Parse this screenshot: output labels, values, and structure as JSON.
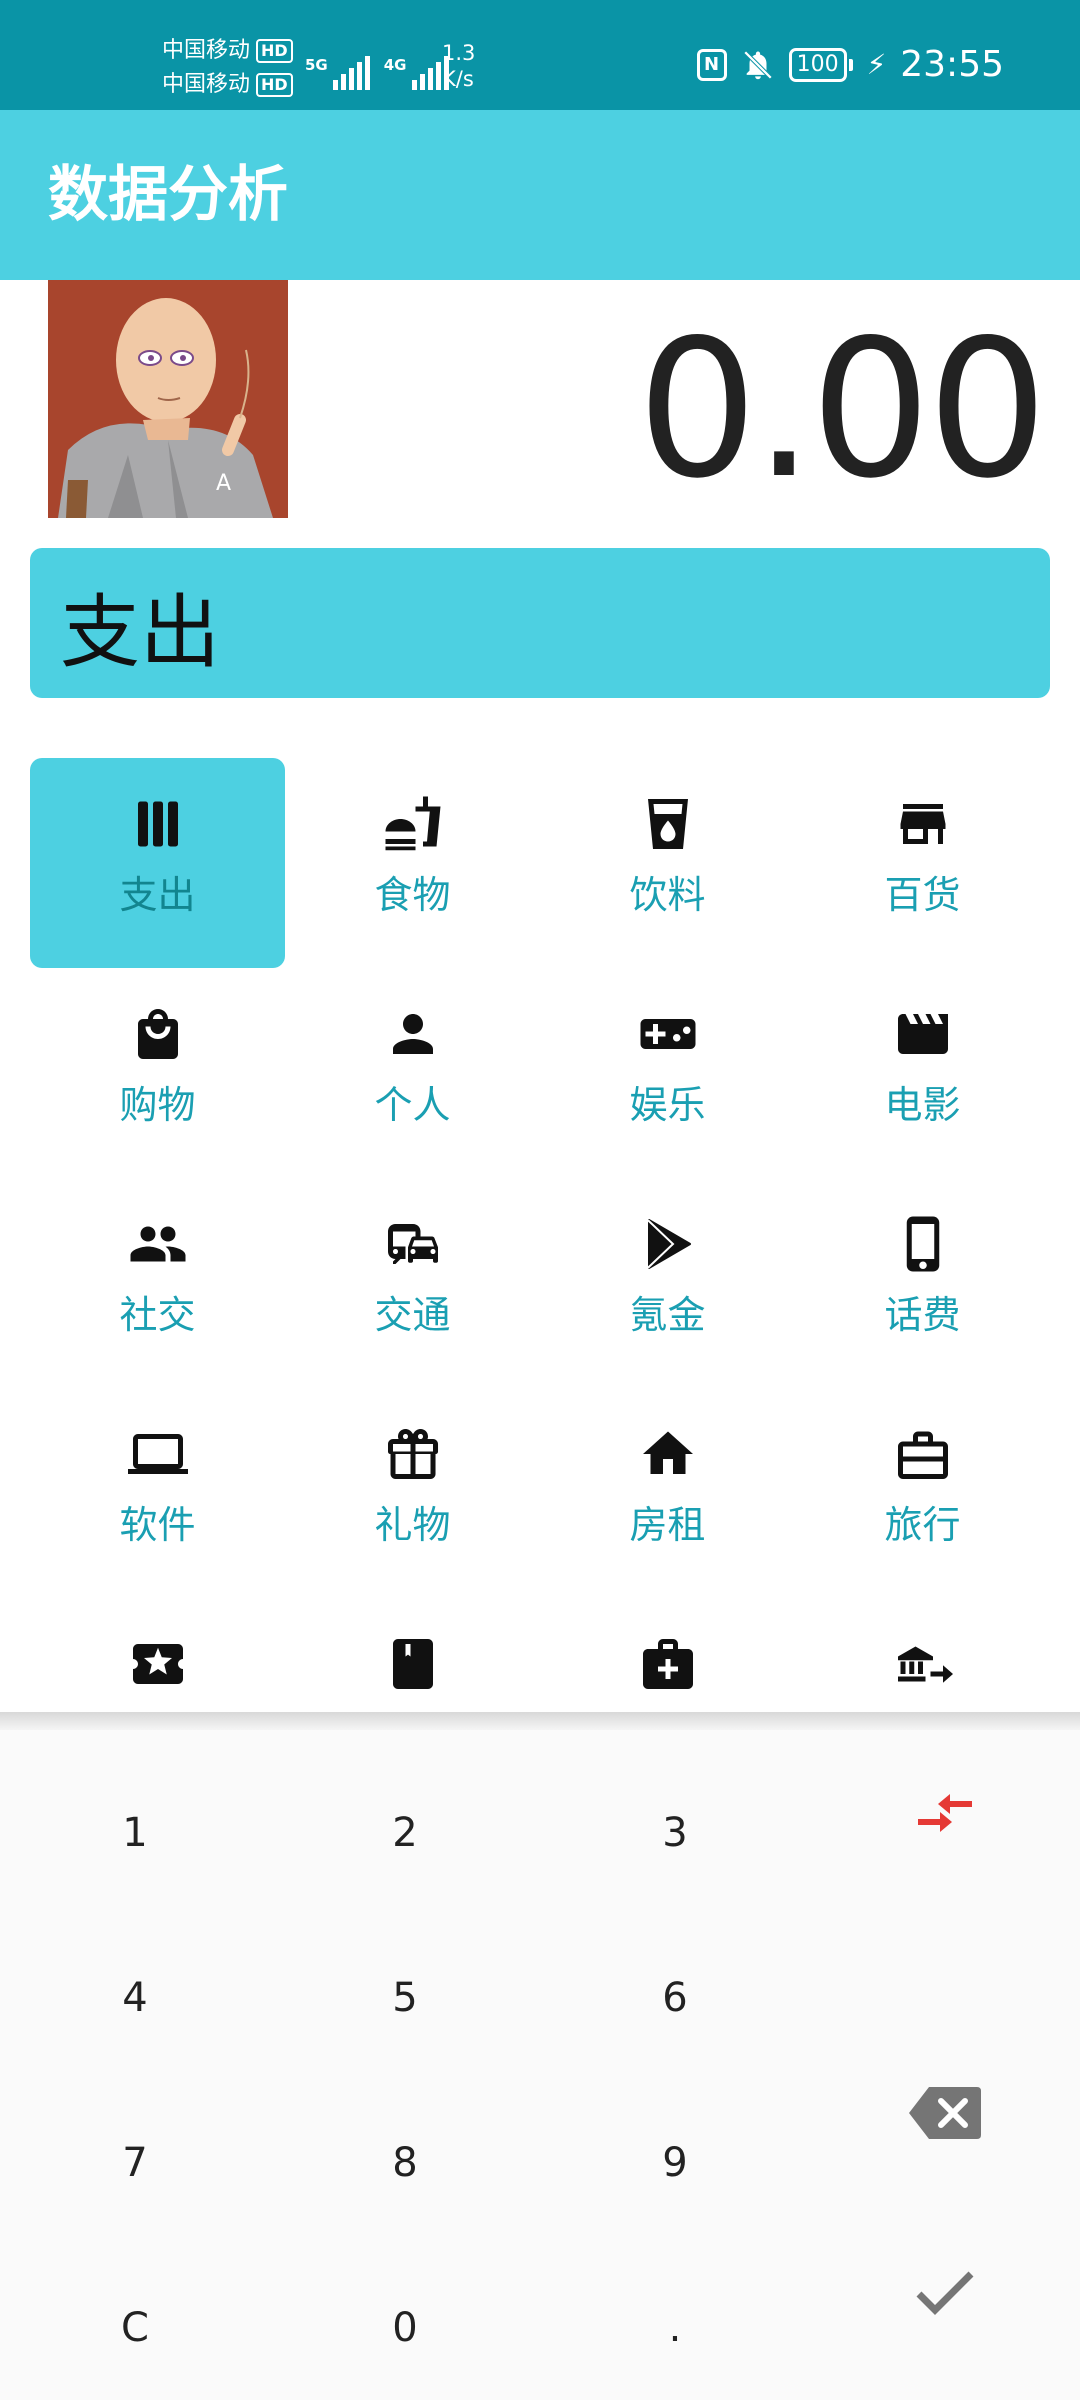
{
  "status_bar": {
    "carrier1": "中国移动",
    "carrier2": "中国移动",
    "hd": "HD",
    "net1": "5G",
    "net2": "4G",
    "speed_value": "1.3",
    "speed_unit": "K/s",
    "nfc": "N",
    "battery": "100",
    "time": "23:55"
  },
  "app_bar": {
    "title": "数据分析"
  },
  "amount": "0.00",
  "type_banner": "支出",
  "categories": [
    {
      "label": "支出",
      "icon": "bars-icon",
      "selected": true
    },
    {
      "label": "食物",
      "icon": "fastfood-icon"
    },
    {
      "label": "饮料",
      "icon": "drink-icon"
    },
    {
      "label": "百货",
      "icon": "store-icon"
    },
    {
      "label": "购物",
      "icon": "shopping-bag-icon"
    },
    {
      "label": "个人",
      "icon": "person-icon"
    },
    {
      "label": "娱乐",
      "icon": "gamepad-icon"
    },
    {
      "label": "电影",
      "icon": "movie-icon"
    },
    {
      "label": "社交",
      "icon": "people-icon"
    },
    {
      "label": "交通",
      "icon": "commute-icon"
    },
    {
      "label": "氪金",
      "icon": "play-store-icon"
    },
    {
      "label": "话费",
      "icon": "phone-icon"
    },
    {
      "label": "软件",
      "icon": "laptop-icon"
    },
    {
      "label": "礼物",
      "icon": "gift-icon"
    },
    {
      "label": "房租",
      "icon": "home-icon"
    },
    {
      "label": "旅行",
      "icon": "suitcase-icon"
    },
    {
      "label": "",
      "icon": "ticket-icon"
    },
    {
      "label": "",
      "icon": "book-icon"
    },
    {
      "label": "",
      "icon": "medical-icon"
    },
    {
      "label": "",
      "icon": "bank-transfer-icon"
    }
  ],
  "keypad": {
    "keys": [
      "1",
      "2",
      "3",
      "4",
      "5",
      "6",
      "7",
      "8",
      "9",
      "C",
      "0",
      "."
    ],
    "side_icons": [
      "transfer-icon",
      "backspace-icon",
      "confirm-check-icon"
    ]
  },
  "colors": {
    "status_bar": "#0a94a6",
    "accent": "#4dd0e1",
    "label": "#1a9fb2",
    "transfer_red": "#e53935"
  }
}
